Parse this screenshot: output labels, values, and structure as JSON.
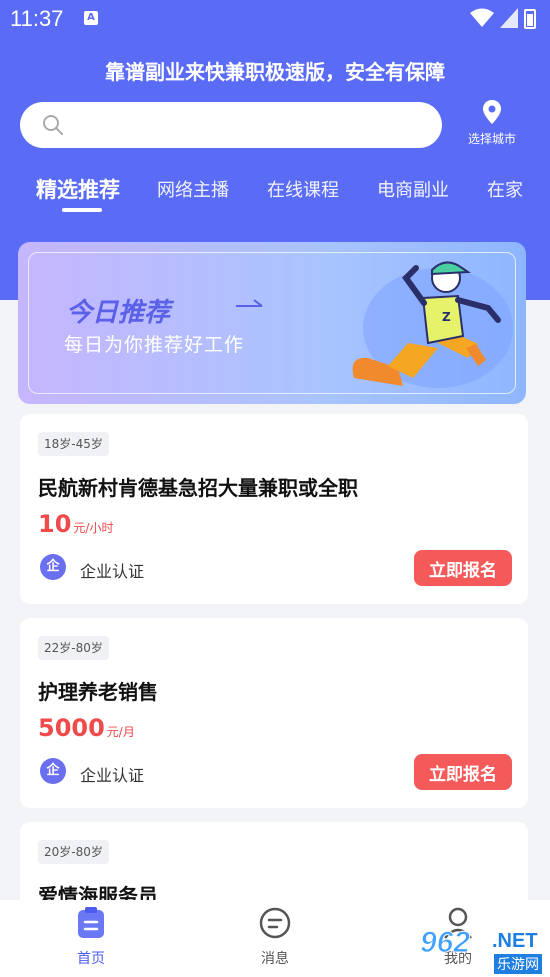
{
  "status": {
    "time": "11:37"
  },
  "header": {
    "title": "靠谱副业来快兼职极速版，安全有保障",
    "search_placeholder": "",
    "city_label": "选择城市"
  },
  "tabs": [
    "精选推荐",
    "网络主播",
    "在线课程",
    "电商副业",
    "在家"
  ],
  "banner": {
    "title": "今日推荐",
    "subtitle": "每日为你推荐好工作"
  },
  "jobs": [
    {
      "age": "18岁-45岁",
      "title": "民航新村肯德基急招大量兼职或全职",
      "salary": "10",
      "unit": "元/小时",
      "verify": "企业认证",
      "verify_icon": "企",
      "button": "立即报名"
    },
    {
      "age": "22岁-80岁",
      "title": "护理养老销售",
      "salary": "5000",
      "unit": "元/月",
      "verify": "企业认证",
      "verify_icon": "企",
      "button": "立即报名"
    },
    {
      "age": "20岁-80岁",
      "title": "爱情海服务员"
    }
  ],
  "nav": [
    {
      "label": "首页",
      "icon": "clipboard-icon",
      "active": true
    },
    {
      "label": "消息",
      "icon": "message-icon"
    },
    {
      "label": "我的",
      "icon": "user-icon"
    }
  ],
  "watermark": {
    "num": "962",
    "net": ".NET",
    "cn": "乐游网"
  },
  "colors": {
    "brand": "#5a6cf5",
    "accent": "#f55a5a",
    "active_nav": "#4b5bf0"
  }
}
